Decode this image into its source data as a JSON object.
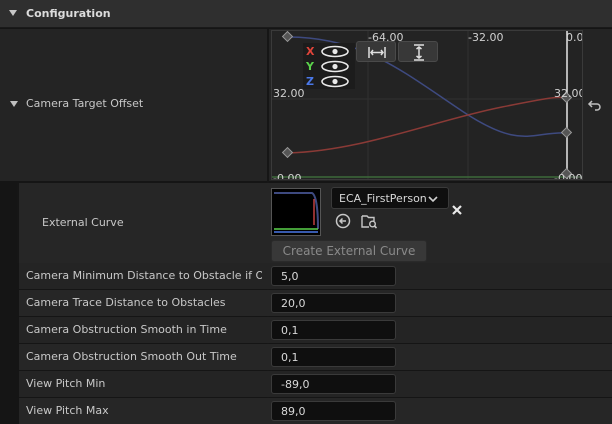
{
  "section": {
    "title": "Configuration",
    "chevron_icon": "chevron-down-icon"
  },
  "camera_target_offset": {
    "label": "Camera Target Offset",
    "reset_icon": "reset-to-default-icon",
    "curve_editor": {
      "x_ticks": [
        "-64.00",
        "-32.00",
        "0.0"
      ],
      "y_labels": [
        "32.00",
        "32.00"
      ],
      "bottom_labels": [
        "-0.00",
        "-0.00"
      ],
      "channels": [
        {
          "key": "X",
          "color": "#e0443a",
          "visible_icon": "eye-icon"
        },
        {
          "key": "Y",
          "color": "#5bd24b",
          "visible_icon": "eye-icon"
        },
        {
          "key": "Z",
          "color": "#4a78e8",
          "visible_icon": "eye-icon"
        }
      ],
      "toolbar": [
        "fit-horizontal-icon",
        "fit-vertical-icon"
      ],
      "curve_colors": {
        "x": "#8a3a36",
        "y": "#3d6a3a",
        "z": "#3e4a80",
        "cursor": "#e8e8e8"
      }
    }
  },
  "external_curve": {
    "label": "External Curve",
    "asset_name": "ECA_FirstPerson",
    "use_icon": "use-selected-arrow-icon",
    "browse_icon": "browse-asset-icon",
    "clear_icon": "clear-x-icon",
    "create_button": "Create External Curve"
  },
  "properties": [
    {
      "label": "Camera Minimum Distance to Obstacle if O...",
      "value": "5,0"
    },
    {
      "label": "Camera Trace Distance to Obstacles",
      "value": "20,0"
    },
    {
      "label": "Camera Obstruction Smooth in Time",
      "value": "0,1"
    },
    {
      "label": "Camera Obstruction Smooth Out Time",
      "value": "0,1"
    },
    {
      "label": "View Pitch Min",
      "value": "-89,0"
    },
    {
      "label": "View Pitch Max",
      "value": "89,0"
    }
  ]
}
